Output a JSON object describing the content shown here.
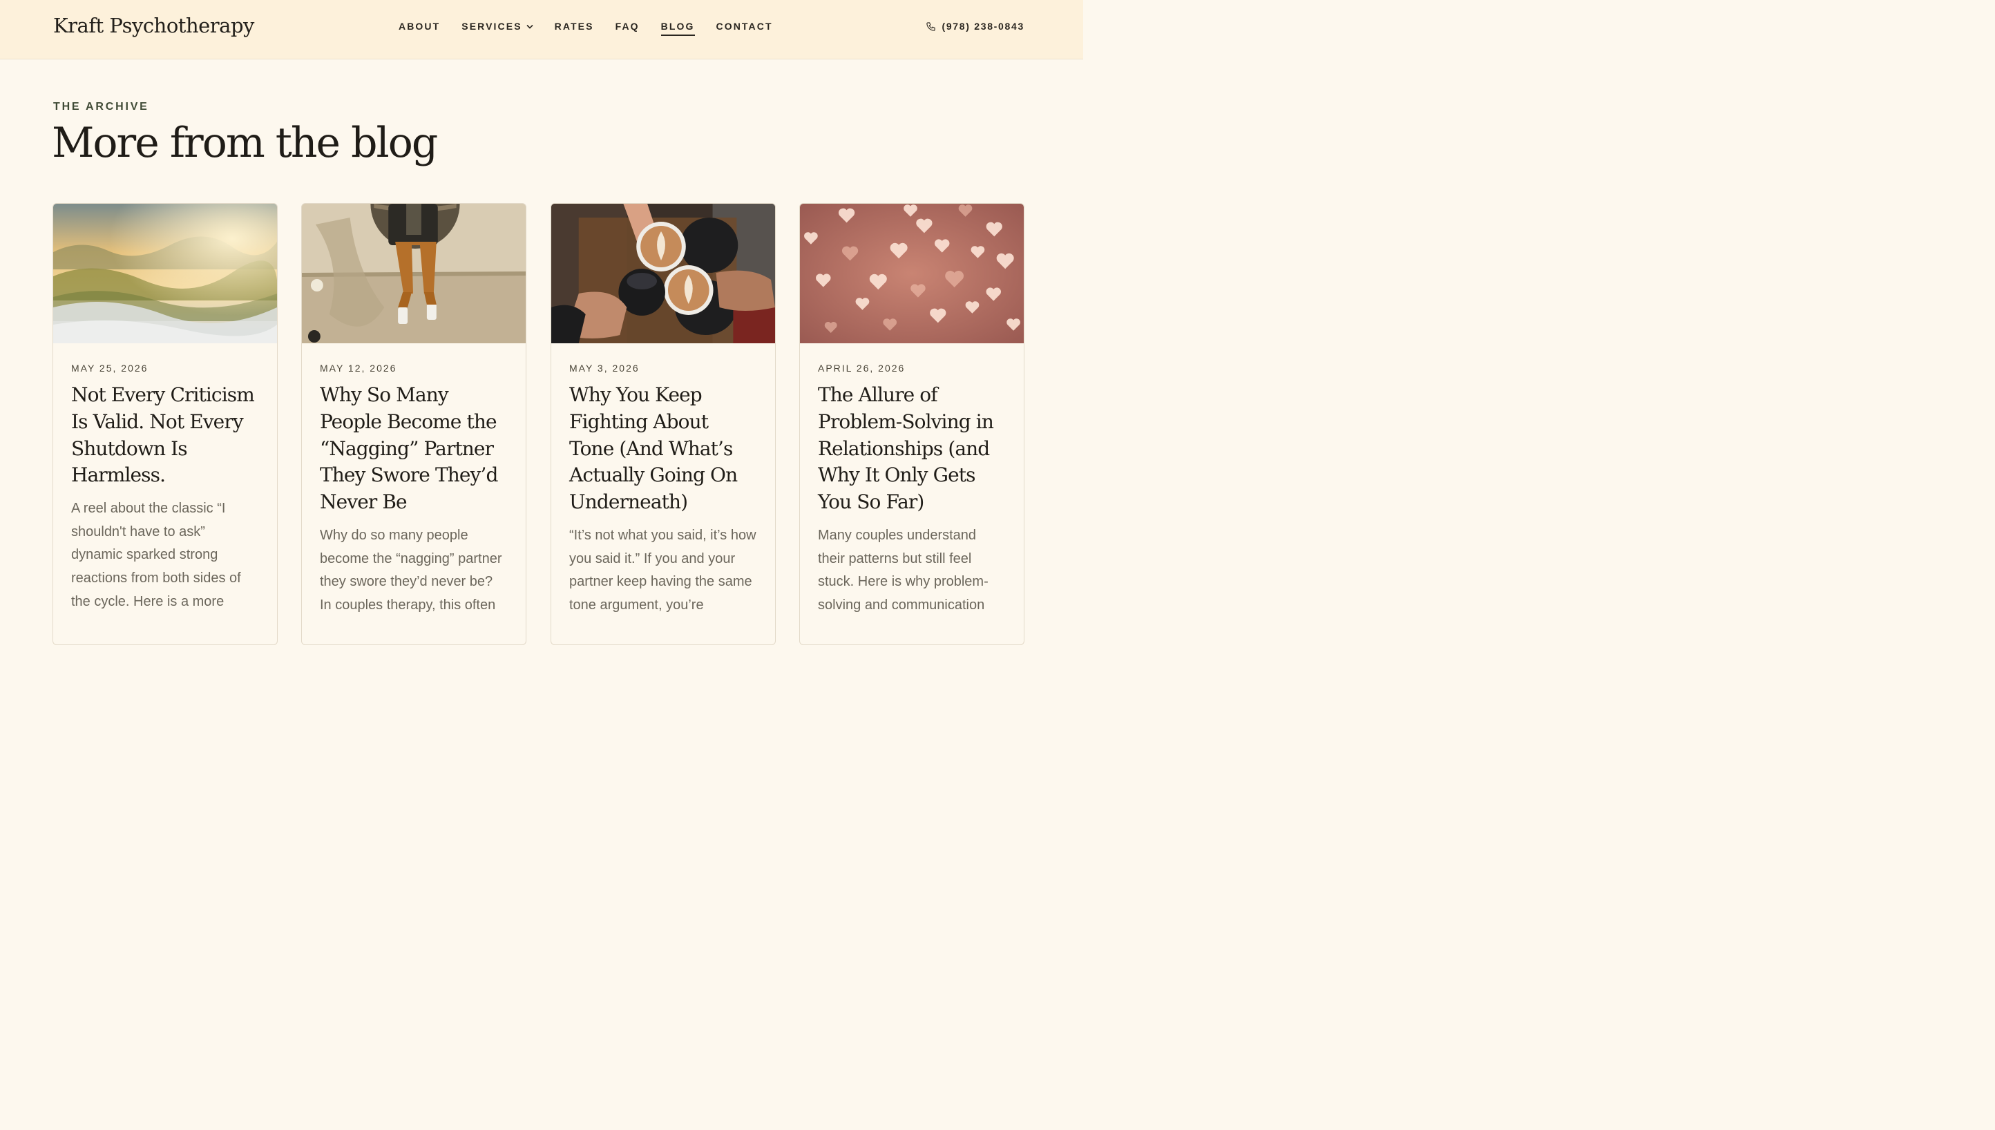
{
  "header": {
    "logo": "Kraft Psychotherapy",
    "nav": [
      {
        "label": "ABOUT"
      },
      {
        "label": "SERVICES"
      },
      {
        "label": "RATES"
      },
      {
        "label": "FAQ"
      },
      {
        "label": "BLOG"
      },
      {
        "label": "CONTACT"
      }
    ],
    "active_nav": "BLOG",
    "phone": "(978) 238-0843"
  },
  "section": {
    "eyebrow": "THE ARCHIVE",
    "title": "More from the blog"
  },
  "posts": [
    {
      "image": "misty-hills-sunrise",
      "date": "MAY 25, 2026",
      "title": "Not Every Criticism Is Valid. Not Every Shutdown Is Harmless.",
      "excerpt": "A reel about the classic “I shouldn't have to ask” dynamic sparked strong reactions from both sides of the cycle. Here is a more"
    },
    {
      "image": "person-sitting-on-wall",
      "date": "MAY 12, 2026",
      "title": "Why So Many People Become the “Nagging” Partner They Swore They’d Never Be",
      "excerpt": "Why do so many people become the “nagging” partner they swore they’d never be? In couples therapy, this often"
    },
    {
      "image": "coffee-cups-toast",
      "date": "MAY 3, 2026",
      "title": "Why You Keep Fighting About Tone (And What’s Actually Going On Underneath)",
      "excerpt": "“It’s not what you said, it’s how you said it.” If you and your partner keep having the same tone argument, you’re"
    },
    {
      "image": "bokeh-hearts",
      "date": "APRIL 26, 2026",
      "title": "The Allure of Problem-Solving in Relationships (and Why It Only Gets You So Far)",
      "excerpt": "Many couples understand their patterns but still feel stuck. Here is why problem-solving and communication"
    }
  ],
  "colors": {
    "background": "#fdf8ee",
    "header_bg": "#fdf1db",
    "eyebrow": "#3f4a35",
    "excerpt": "#6b665b"
  }
}
